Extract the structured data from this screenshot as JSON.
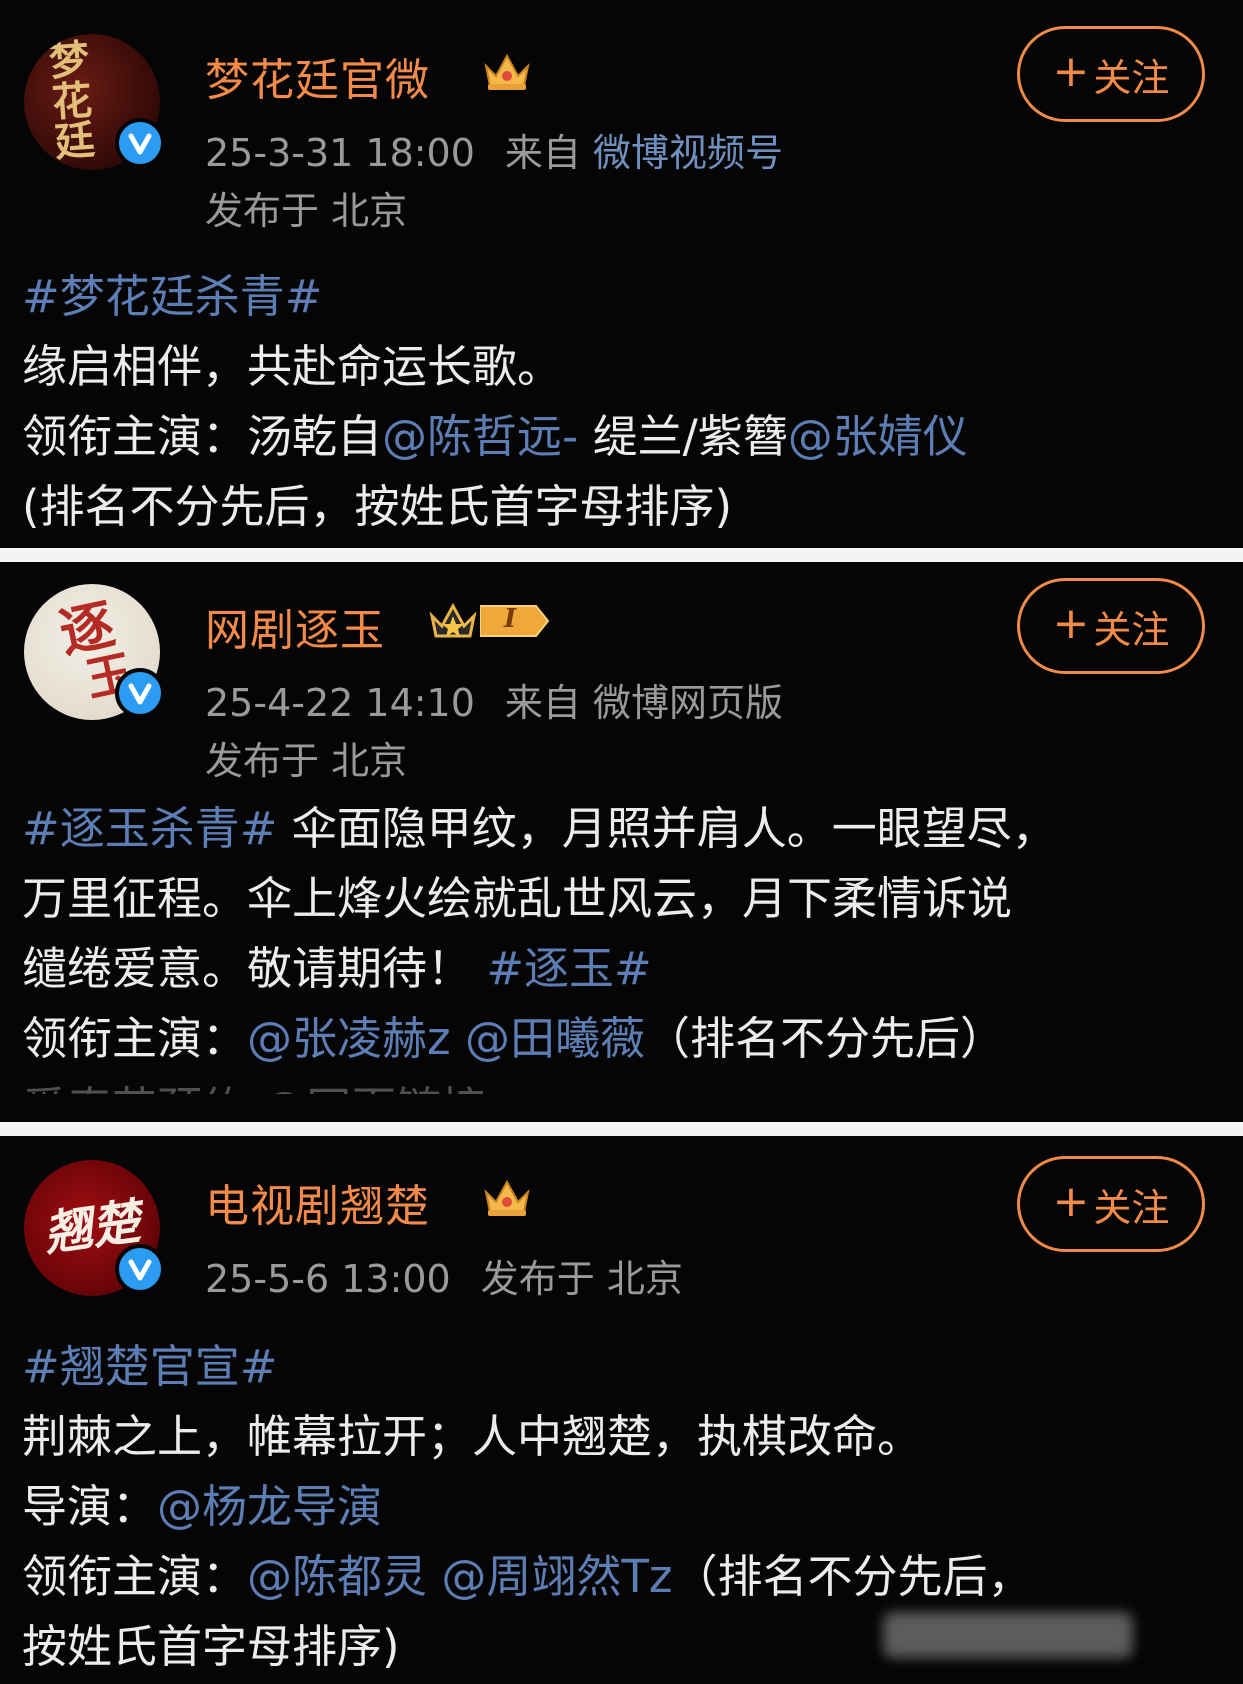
{
  "posts": [
    {
      "username": "梦花廷官微",
      "avatar_text": [
        "梦",
        "花",
        "廷"
      ],
      "follow_label": "关注",
      "timestamp": "25-3-31 18:00",
      "source_prefix": "来自",
      "source": "微博视频号",
      "location": "发布于 北京",
      "hashtag": "#梦花廷杀青#",
      "line1": "缘启相伴，共赴命运长歌。",
      "lead_label": "领衔主演：汤乾自",
      "mention1": "@陈哲远-",
      "lead_mid": " 缇兰/紫簪",
      "mention2": "@张婧仪",
      "note": "(排名不分先后，按姓氏首字母排序)"
    },
    {
      "username": "网剧逐玉",
      "avatar_text": [
        "逐",
        "玉"
      ],
      "level_badge": "I",
      "follow_label": "关注",
      "timestamp": "25-4-22 14:10",
      "source_prefix": "来自",
      "source": "微博网页版",
      "location": "发布于 北京",
      "hashtag": "#逐玉杀青#",
      "line1_rest": " 伞面隐甲纹，月照并肩人。一眼望尽，",
      "line2": "万里征程。伞上烽火绘就乱世风云，月下柔情诉说",
      "line3": "缱绻爱意。敬请期待！",
      "hashtag2": "#逐玉#",
      "lead_label": "领衔主演：",
      "mention1": "@张凌赫z",
      "mention2": "@田曦薇",
      "note": "（排名不分先后）",
      "faded": "爱奇艺预约 @网页链接"
    },
    {
      "username": "电视剧翘楚",
      "avatar_text": [
        "翘",
        "楚"
      ],
      "follow_label": "关注",
      "timestamp": "25-5-6 13:00",
      "location": "发布于 北京",
      "hashtag": "#翘楚官宣#",
      "line1": "荆棘之上，帷幕拉开；人中翘楚，执棋改命。",
      "director_label": "导演：",
      "director": "@杨龙导演",
      "lead_label": "领衔主演：",
      "mention1": "@陈都灵",
      "mention2": "@周翊然Tz",
      "note_start": "（排名不分先后，",
      "note_end": "按姓氏首字母排序)"
    }
  ],
  "colors": {
    "accent": "#f28a4a",
    "link": "#5c7eb4",
    "verify": "#2b9cf2",
    "divider": "#f4f4f4"
  },
  "icons": [
    "verified-icon",
    "crown-icon",
    "level-badge-icon",
    "plus-icon"
  ]
}
